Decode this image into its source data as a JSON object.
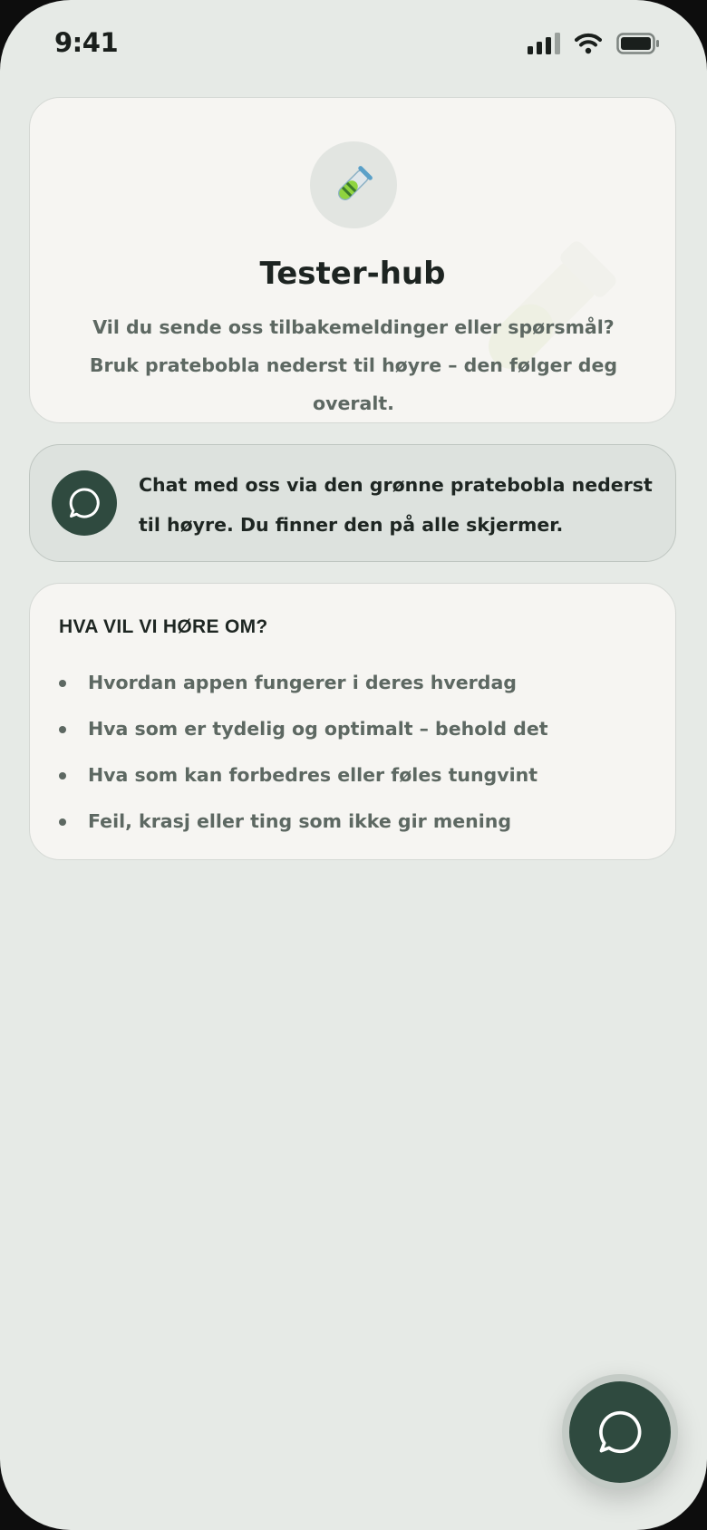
{
  "status_bar": {
    "time": "9:41",
    "icons": [
      "cellular-signal-icon",
      "wifi-icon",
      "battery-icon"
    ]
  },
  "hero": {
    "icon": "test-tube-icon",
    "title": "Tester-hub",
    "description": "Vil du sende oss tilbakemeldinger eller spørsmål? Bruk pratebobla nederst til høyre – den følger deg overalt."
  },
  "info_banner": {
    "icon": "chat-bubble-icon",
    "text": "Chat med oss via den grønne pratebobla nederst til høyre. Du finner den på alle skjermer."
  },
  "feedback_topics": {
    "heading": "HVA VIL VI HØRE OM?",
    "items": [
      "Hvordan appen fungerer i deres hverdag",
      "Hva som er tydelig og optimalt – behold det",
      "Hva som kan forbedres eller føles tungvint",
      "Feil, krasj eller ting som ikke gir mening"
    ]
  },
  "chat_fab": {
    "icon": "chat-bubble-icon"
  },
  "colors": {
    "background": "#e6eae6",
    "card": "#f6f5f2",
    "accent_dark_green": "#2f4a3f",
    "text_primary": "#1d2421",
    "text_secondary": "#5d6862"
  }
}
